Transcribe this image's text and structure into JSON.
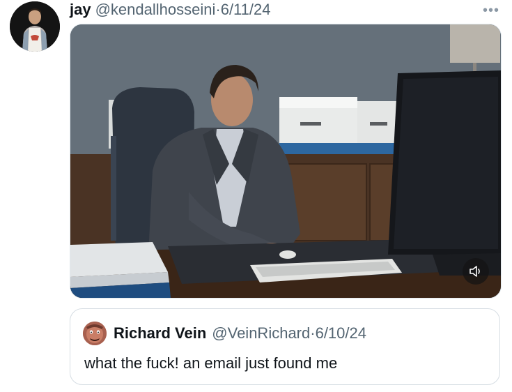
{
  "post": {
    "author_name": "jay",
    "author_handle": "@kendallhosseini",
    "separator": " · ",
    "date": "6/11/24",
    "more_label": "•••",
    "avatar_icon": "profile-photo-avatar",
    "media": {
      "type": "video",
      "muted": true,
      "volume_icon": "speaker-volume-icon"
    }
  },
  "quoted_post": {
    "author_name": "Richard Vein",
    "author_handle": "@VeinRichard",
    "separator": " · ",
    "date": "6/10/24",
    "text": "what the fuck! an email just found me",
    "avatar_icon": "profile-photo-avatar"
  },
  "colors": {
    "text_primary": "#0f1419",
    "text_secondary": "#536471",
    "border": "#d6dde3"
  }
}
